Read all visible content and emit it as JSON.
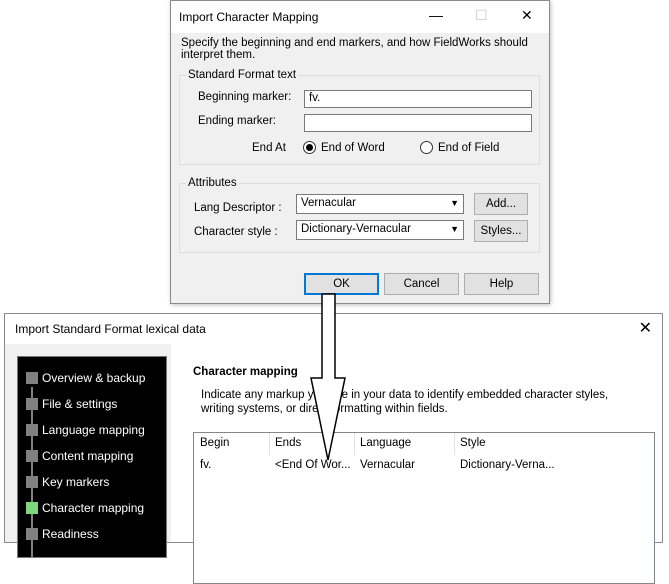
{
  "back": {
    "title": "Import Standard Format lexical data",
    "close": "✕",
    "steps": [
      {
        "label": "Overview & backup",
        "active": false
      },
      {
        "label": "File & settings",
        "active": false
      },
      {
        "label": "Language mapping",
        "active": false
      },
      {
        "label": "Content mapping",
        "active": false
      },
      {
        "label": "Key markers",
        "active": false
      },
      {
        "label": "Character mapping",
        "active": true
      },
      {
        "label": "Readiness",
        "active": false
      }
    ],
    "section_title": "Character mapping",
    "instruction": "Indicate any markup you use in your data to identify embedded character styles, writing systems, or direct formatting within fields.",
    "table": {
      "headers": [
        "Begin",
        "Ends",
        "Language",
        "Style"
      ],
      "rows": [
        [
          "fv.",
          "<End Of Wor...",
          "Vernacular",
          "Dictionary-Verna..."
        ]
      ]
    }
  },
  "dialog": {
    "title": "Import Character Mapping",
    "minimize": "—",
    "maximize": "☐",
    "close": "✕",
    "description": "Specify the beginning and end markers, and how FieldWorks should interpret them.",
    "sf_group": "Standard Format text",
    "begin_label": "Beginning marker:",
    "begin_value": "fv.",
    "end_label": "Ending marker:",
    "end_value": "",
    "end_at_label": "End At",
    "radio_word": "End of Word",
    "radio_field": "End of Field",
    "attr_group": "Attributes",
    "lang_label": "Lang Descriptor :",
    "lang_value": "Vernacular",
    "style_label": "Character style :",
    "style_value": "Dictionary-Vernacular",
    "add_button": "Add...",
    "styles_button": "Styles...",
    "ok_button": "OK",
    "cancel_button": "Cancel",
    "help_button": "Help"
  }
}
